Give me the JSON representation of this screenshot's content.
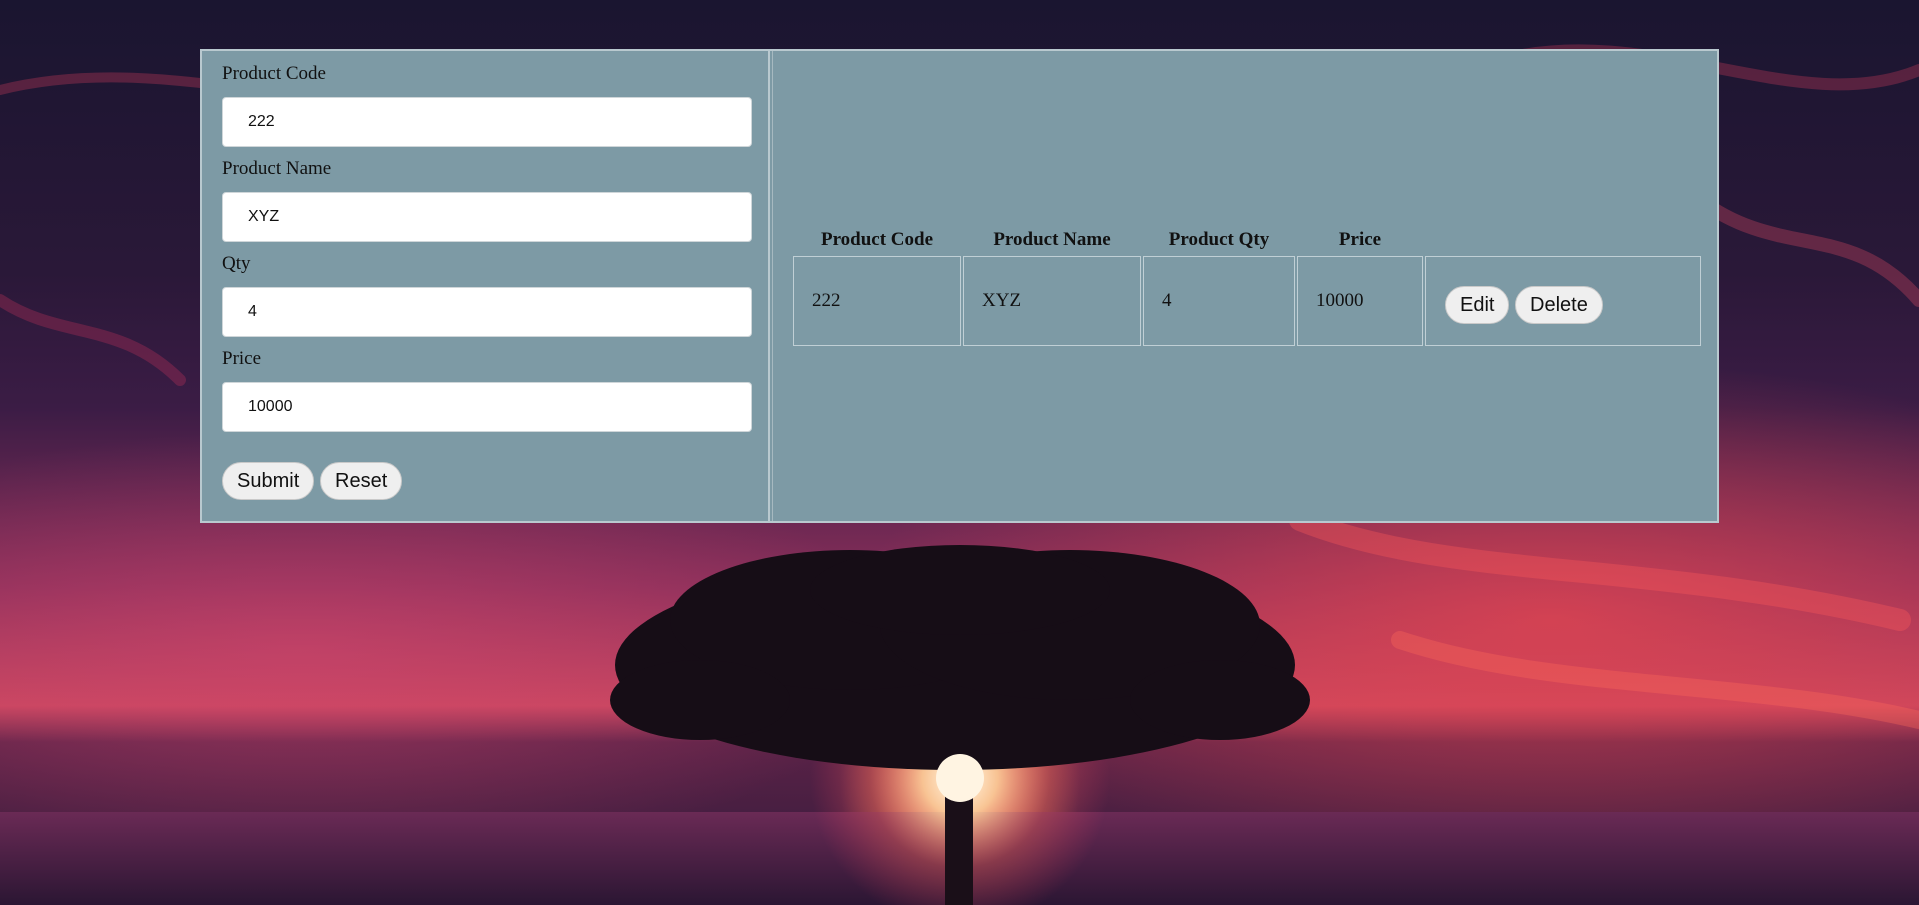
{
  "form": {
    "product_code": {
      "label": "Product Code",
      "value": "222"
    },
    "product_name": {
      "label": "Product Name",
      "value": "XYZ"
    },
    "qty": {
      "label": "Qty",
      "value": "4"
    },
    "price": {
      "label": "Price",
      "value": "10000"
    },
    "submit_label": "Submit",
    "reset_label": "Reset"
  },
  "table": {
    "headers": [
      "Product Code",
      "Product Name",
      "Product Qty",
      "Price"
    ],
    "rows": [
      {
        "code": "222",
        "name": "XYZ",
        "qty": "4",
        "price": "10000",
        "edit_label": "Edit",
        "delete_label": "Delete"
      }
    ]
  },
  "colors": {
    "panel_bg": "#7d9aa5",
    "panel_border": "#b9c9cf"
  },
  "background": {
    "icon": "sunset-tree-wallpaper"
  }
}
